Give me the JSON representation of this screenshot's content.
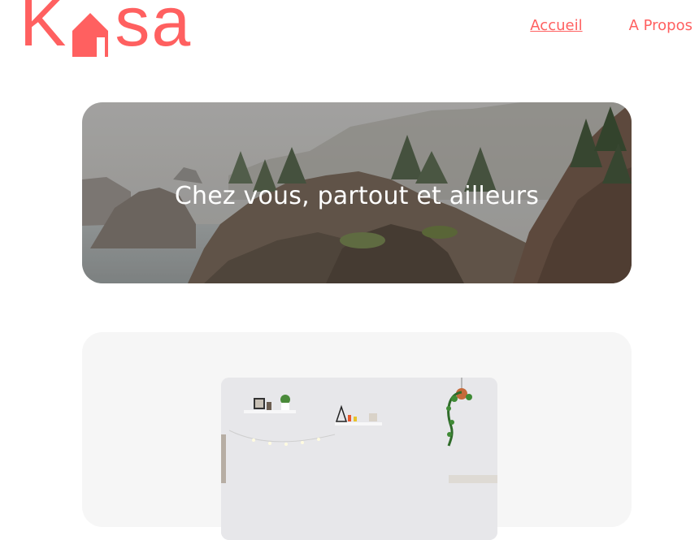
{
  "header": {
    "logo_text": "Kasa",
    "logo_first_letter": "K",
    "logo_last_letters": "sa",
    "nav": [
      {
        "label": "Accueil",
        "active": true
      },
      {
        "label": "A Propos",
        "active": false
      }
    ]
  },
  "banner": {
    "title": "Chez vous, partout et ailleurs"
  },
  "gallery": {
    "cards": [
      {
        "image": "interior-room-photo"
      }
    ]
  },
  "colors": {
    "brand": "#FF6060",
    "gallery_bg": "#F6F6F6",
    "white": "#FFFFFF"
  },
  "icons": [
    "house-icon"
  ]
}
